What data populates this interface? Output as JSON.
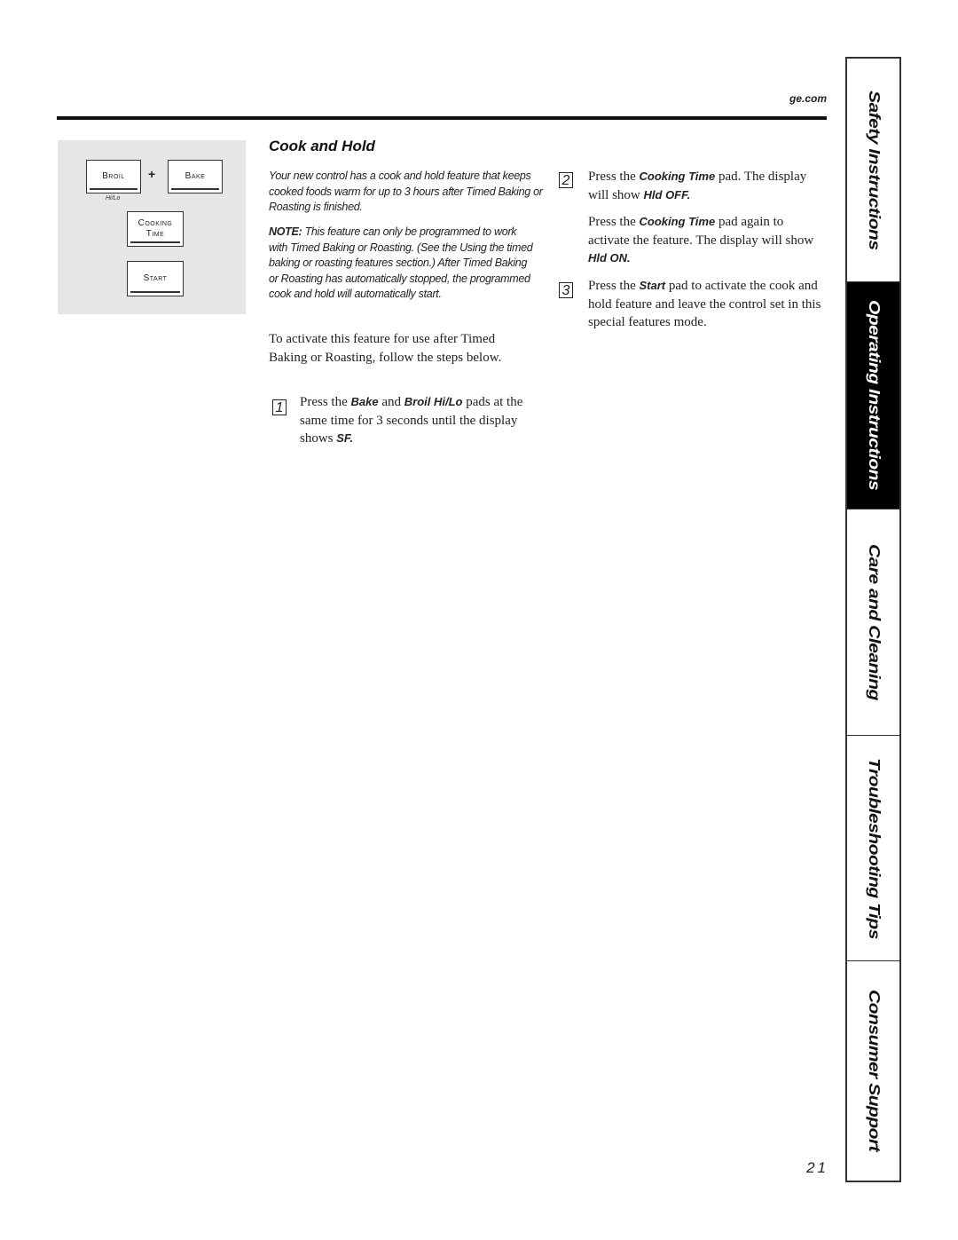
{
  "header": {
    "site": "ge.com"
  },
  "control_panel": {
    "pads": {
      "broil": "Broil",
      "plus": "+",
      "bake": "Bake",
      "hilo": "Hi/Lo",
      "cooking_line1": "Cooking",
      "cooking_line2": "Time",
      "start": "Start"
    }
  },
  "section": {
    "title": "Cook and Hold",
    "intro": "Your new control has a cook and hold feature that keeps cooked foods warm for up to 3 hours after Timed Baking or Roasting is finished.",
    "note_label": "NOTE:",
    "note_text": " This feature can only be programmed to work with Timed Baking or Roasting. (See the Using the timed baking or roasting features section.) After Timed Baking or Roasting has automatically stopped, the programmed cook and hold will automatically start.",
    "activate": "To activate this feature for use after Timed Baking or Roasting, follow the steps below."
  },
  "steps": [
    {
      "number": "1",
      "parts": [
        "Press the ",
        "Bake",
        " and ",
        "Broil Hi/Lo",
        " pads at the same time for 3 seconds until the display shows ",
        "SF."
      ]
    },
    {
      "number": "2",
      "parts": [
        "Press the ",
        "Cooking Time",
        " pad. The display will show ",
        "Hld OFF."
      ],
      "extra_parts": [
        "Press the ",
        "Cooking Time",
        " pad again to activate the feature. The display will show ",
        "Hld ON."
      ]
    },
    {
      "number": "3",
      "parts": [
        "Press the ",
        "Start",
        " pad to activate the cook and hold feature and leave the control set in this special features mode."
      ]
    }
  ],
  "side_tabs": [
    {
      "label": "Safety Instructions",
      "active": false
    },
    {
      "label": "Operating Instructions",
      "active": true
    },
    {
      "label": "Care and Cleaning",
      "active": false
    },
    {
      "label": "Troubleshooting Tips",
      "active": false
    },
    {
      "label": "Consumer Support",
      "active": false
    }
  ],
  "footer": {
    "page_number": "21"
  }
}
